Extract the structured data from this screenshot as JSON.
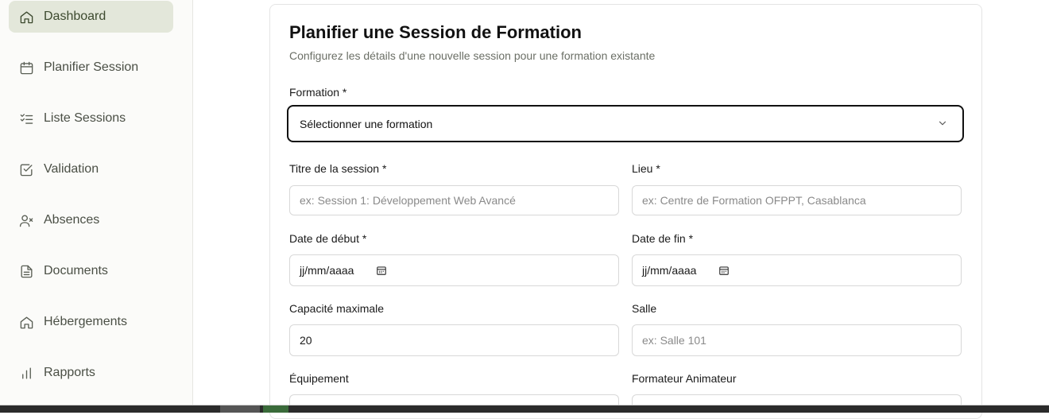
{
  "sidebar": {
    "items": [
      {
        "label": "Dashboard",
        "icon": "home-icon",
        "active": true
      },
      {
        "label": "Planifier Session",
        "icon": "calendar-icon",
        "active": false
      },
      {
        "label": "Liste Sessions",
        "icon": "list-check-icon",
        "active": false
      },
      {
        "label": "Validation",
        "icon": "check-square-icon",
        "active": false
      },
      {
        "label": "Absences",
        "icon": "user-x-icon",
        "active": false
      },
      {
        "label": "Documents",
        "icon": "file-icon",
        "active": false
      },
      {
        "label": "Hébergements",
        "icon": "home-icon",
        "active": false
      },
      {
        "label": "Rapports",
        "icon": "bar-chart-icon",
        "active": false
      }
    ]
  },
  "form": {
    "title": "Planifier une Session de Formation",
    "subtitle": "Configurez les détails d'une nouvelle session pour une formation existante",
    "formation_label": "Formation *",
    "formation_value": "Sélectionner une formation",
    "titre_label": "Titre de la session *",
    "titre_placeholder": "ex: Session 1: Développement Web Avancé",
    "lieu_label": "Lieu *",
    "lieu_placeholder": "ex: Centre de Formation OFPPT, Casablanca",
    "date_debut_label": "Date de début *",
    "date_debut_value": "jj/mm/aaaa",
    "date_fin_label": "Date de fin *",
    "date_fin_value": "jj/mm/aaaa",
    "capacite_label": "Capacité maximale",
    "capacite_value": "20",
    "salle_label": "Salle",
    "salle_placeholder": "ex: Salle 101",
    "equipement_label": "Équipement",
    "formateur_label": "Formateur Animateur"
  }
}
